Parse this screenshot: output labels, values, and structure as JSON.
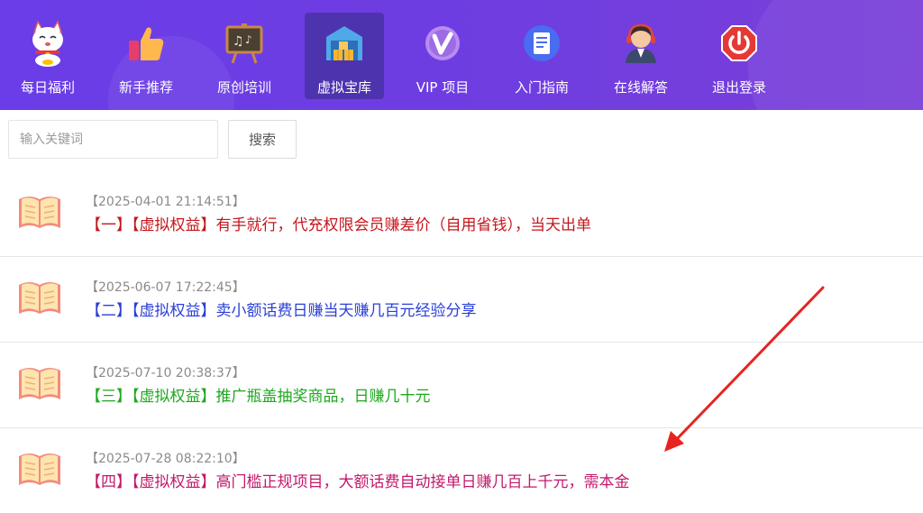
{
  "nav": {
    "items": [
      {
        "label": "每日福利",
        "icon": "lucky-cat-icon"
      },
      {
        "label": "新手推荐",
        "icon": "thumbs-up-icon"
      },
      {
        "label": "原创培训",
        "icon": "chalkboard-icon"
      },
      {
        "label": "虚拟宝库",
        "icon": "warehouse-icon",
        "active": true
      },
      {
        "label": "VIP 项目",
        "icon": "vip-icon"
      },
      {
        "label": "入门指南",
        "icon": "document-icon"
      },
      {
        "label": "在线解答",
        "icon": "customer-service-icon"
      },
      {
        "label": "退出登录",
        "icon": "power-icon"
      }
    ]
  },
  "search": {
    "placeholder": "输入关键词",
    "button_label": "搜索"
  },
  "articles": [
    {
      "date": "【2025-04-01 21:14:51】",
      "title": "【一】【虚拟权益】有手就行，代充权限会员赚差价（自用省钱），当天出单",
      "color": "#c4161c"
    },
    {
      "date": "【2025-06-07 17:22:45】",
      "title": "【二】【虚拟权益】卖小额话费日赚当天赚几百元经验分享",
      "color": "#2a3fd6"
    },
    {
      "date": "【2025-07-10 20:38:37】",
      "title": "【三】【虚拟权益】推广瓶盖抽奖商品，日赚几十元",
      "color": "#1fa81f"
    },
    {
      "date": "【2025-07-28 08:22:10】",
      "title": "【四】【虚拟权益】高门槛正规项目，大额话费自动接单日赚几百上千元，需本金",
      "color": "#c2186b"
    }
  ],
  "theme": {
    "nav_bg": "#6f3de0",
    "arrow": "#e8231f"
  }
}
